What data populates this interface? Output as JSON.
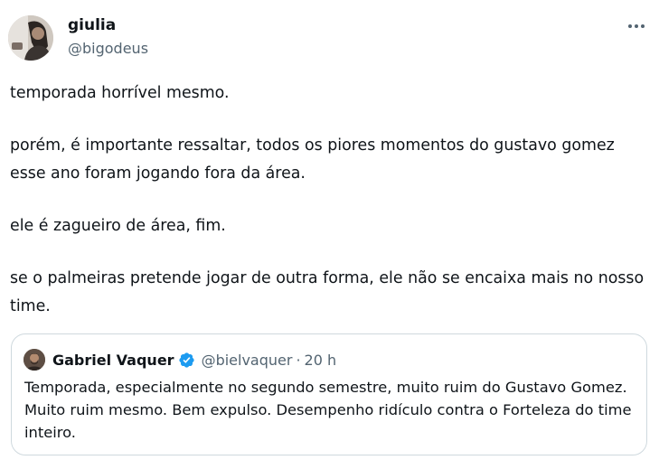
{
  "author": {
    "display_name": "giulia",
    "handle": "@bigodeus"
  },
  "tweet": {
    "paragraphs": [
      "temporada horrível mesmo.",
      "porém, é importante ressaltar, todos os piores momentos do gustavo gomez esse ano foram jogando fora da área.",
      "ele é zagueiro de área, fim.",
      "se o palmeiras pretende jogar de outra forma, ele não se encaixa mais no nosso time."
    ]
  },
  "quote": {
    "display_name": "Gabriel Vaquer",
    "handle": "@bielvaquer",
    "separator": "·",
    "time": "20 h",
    "text": "Temporada, especialmente no segundo semestre, muito ruim do Gustavo Gomez. Muito ruim mesmo. Bem expulso. Desempenho ridículo contra o Forteleza do time inteiro."
  },
  "icons": {
    "more": "more-horizontal-icon",
    "verified": "verified-badge-icon"
  },
  "colors": {
    "text_primary": "#0f1419",
    "text_secondary": "#536471",
    "border": "#cfd9de",
    "verified_blue": "#1d9bf0"
  }
}
